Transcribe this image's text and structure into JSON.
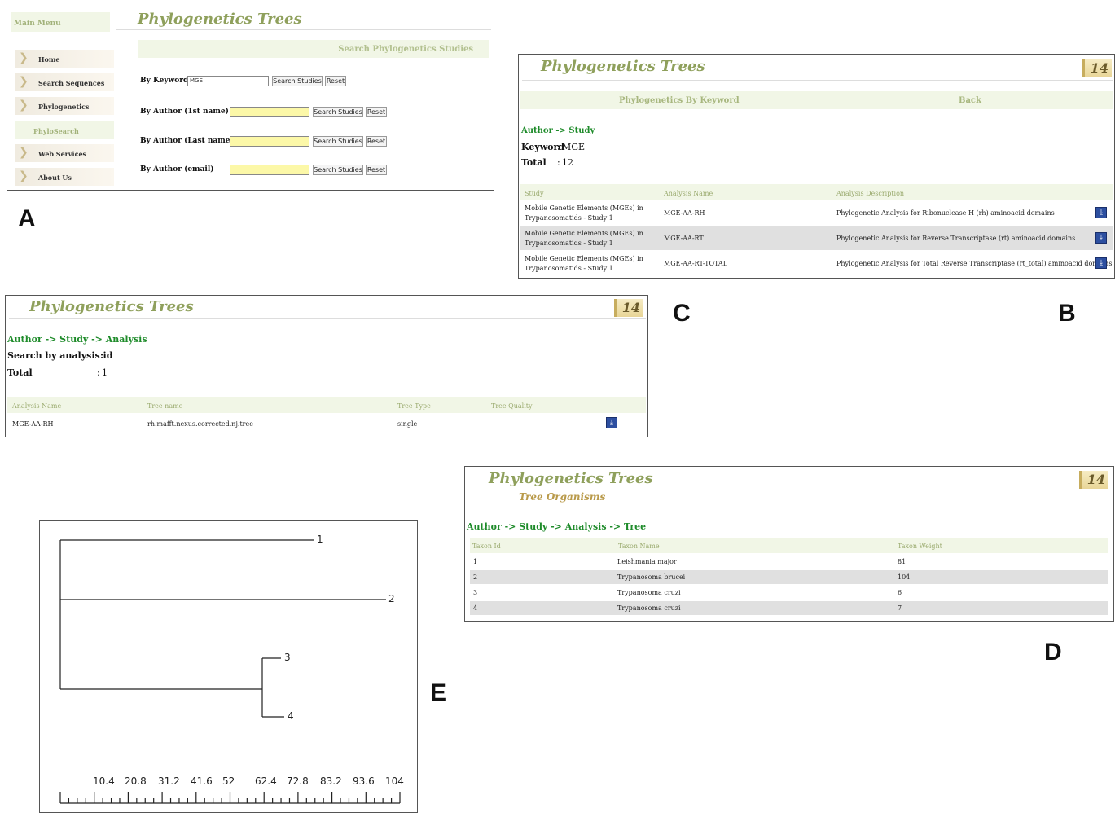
{
  "panel_letters": {
    "a": "A",
    "b": "B",
    "c": "C",
    "d": "D",
    "e": "E"
  },
  "app_title": "Phylogenetics Trees",
  "badge": "14",
  "panel_a": {
    "main_menu": "Main Menu",
    "menu_items": [
      "Home",
      "Search Sequences",
      "Phylogenetics",
      "PhyloSearch",
      "Web Services",
      "About Us"
    ],
    "section_header": "Search Phylogenetics Studies",
    "keyword_label": "By Keyword",
    "keyword_value": "MGE",
    "author_first_label": "By Author (1st name)",
    "author_last_label": "By Author (Last name)",
    "author_email_label": "By Author (email)",
    "search_button": "Search Studies",
    "reset_button": "Reset"
  },
  "panel_b": {
    "tab_keyword": "Phylogenetics By Keyword",
    "tab_back": "Back",
    "breadcrumb": "Author -> Study",
    "keyword_label": "Keyword",
    "keyword_value": "MGE",
    "total_label": "Total",
    "total_value": "12",
    "columns": [
      "Study",
      "Analysis Name",
      "Analysis Description"
    ],
    "rows": [
      {
        "study_line1": "Mobile Genetic Elements (MGEs) in",
        "study_line2": "Trypanosomatids - Study 1",
        "analysis": "MGE-AA-RH",
        "description": "Phylogenetic Analysis for Ribonuclease H (rh) aminoacid domains"
      },
      {
        "study_line1": "Mobile Genetic Elements (MGEs) in",
        "study_line2": "Trypanosomatids - Study 1",
        "analysis": "MGE-AA-RT",
        "description": "Phylogenetic Analysis for Reverse Transcriptase (rt) aminoacid domains"
      },
      {
        "study_line1": "Mobile Genetic Elements (MGEs) in",
        "study_line2": "Trypanosomatids - Study 1",
        "analysis": "MGE-AA-RT-TOTAL",
        "description": "Phylogenetic Analysis for Total Reverse Transcriptase (rt_total) aminoacid domains"
      }
    ]
  },
  "panel_c": {
    "breadcrumb": "Author -> Study -> Analysis",
    "search_label": "Search by analysis id",
    "total_label": "Total",
    "total_value": "1",
    "columns": [
      "Analysis Name",
      "Tree name",
      "Tree Type",
      "Tree Quality"
    ],
    "row": {
      "analysis": "MGE-AA-RH",
      "tree_name": "rh.mafft.nexus.corrected.nj.tree",
      "tree_type": "single",
      "tree_quality": ""
    }
  },
  "panel_d": {
    "subtitle": "Tree Organisms",
    "breadcrumb": "Author -> Study -> Analysis -> Tree",
    "columns": [
      "Taxon Id",
      "Taxon Name",
      "Taxon Weight"
    ],
    "rows": [
      {
        "id": "1",
        "name": "Leishmania major",
        "weight": "81"
      },
      {
        "id": "2",
        "name": "Trypanosoma brucei",
        "weight": "104"
      },
      {
        "id": "3",
        "name": "Trypanosoma cruzi",
        "weight": "6"
      },
      {
        "id": "4",
        "name": "Trypanosoma cruzi",
        "weight": "7"
      }
    ]
  },
  "panel_e": {
    "leaves": [
      "1",
      "2",
      "3",
      "4"
    ],
    "scale_ticks": [
      "10.4",
      "20.8",
      "31.2",
      "41.6",
      "52",
      "62.4",
      "72.8",
      "83.2",
      "93.6",
      "104"
    ]
  },
  "colors": {
    "title_green": "#8fa05c",
    "link_green": "#1e8b2a",
    "header_bg": "#f1f6e6",
    "input_yellow": "#fcf8a8"
  }
}
